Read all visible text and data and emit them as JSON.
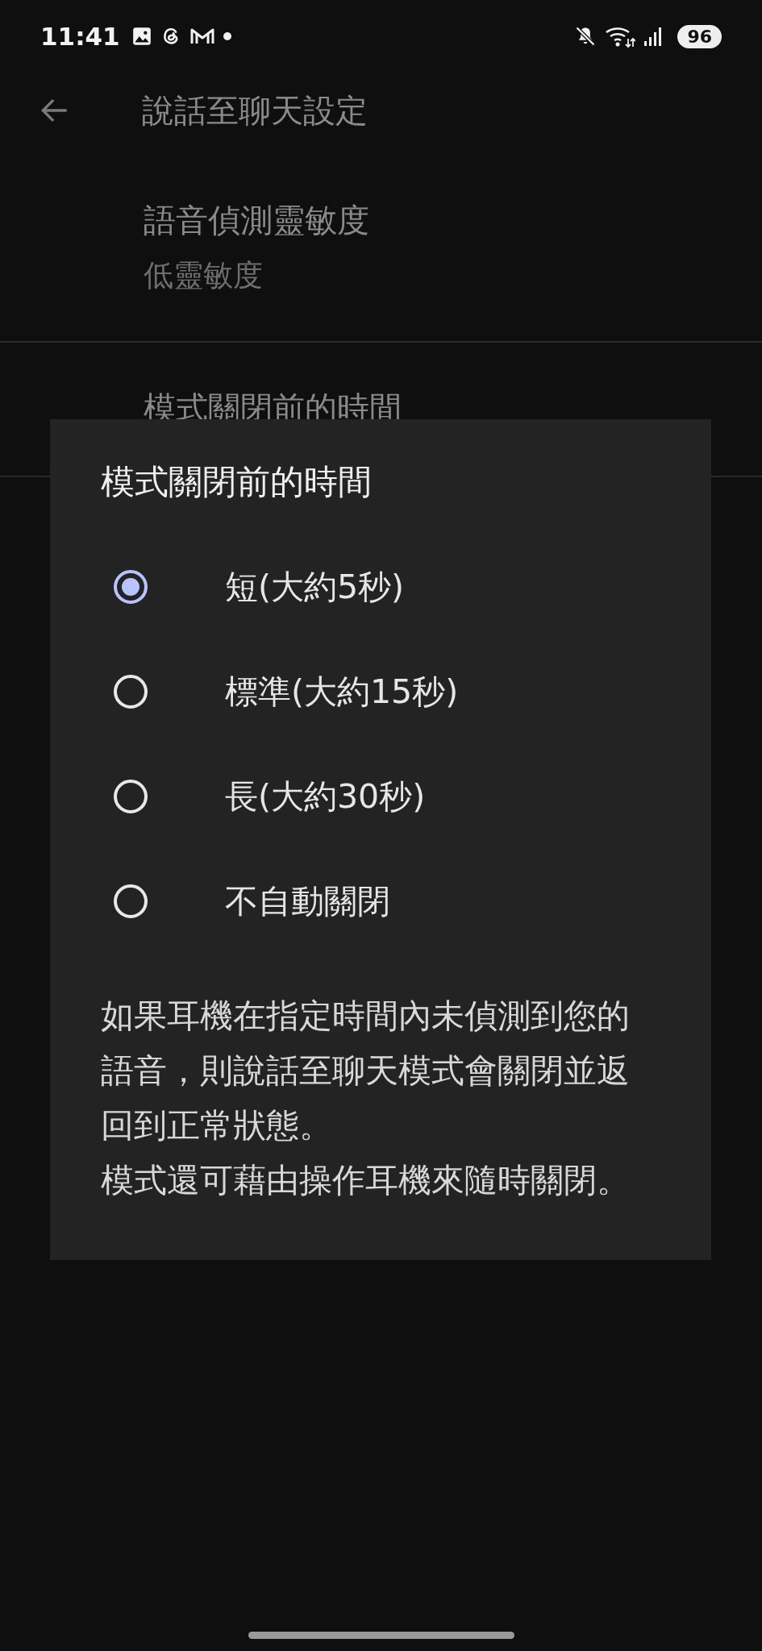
{
  "status_bar": {
    "time": "11:41",
    "battery": "96"
  },
  "header": {
    "title": "說話至聊天設定"
  },
  "settings": [
    {
      "title": "語音偵測靈敏度",
      "subtitle": "低靈敏度"
    },
    {
      "title": "模式關閉前的時間"
    }
  ],
  "dialog": {
    "title": "模式關閉前的時間",
    "options": [
      {
        "label": "短(大約5秒)",
        "selected": true
      },
      {
        "label": "標準(大約15秒)",
        "selected": false
      },
      {
        "label": "長(大約30秒)",
        "selected": false
      },
      {
        "label": "不自動關閉",
        "selected": false
      }
    ],
    "description": [
      "如果耳機在指定時間內未偵測到您的語音，則說話至聊天模式會關閉並返回到正常狀態。",
      "模式還可藉由操作耳機來隨時關閉。"
    ]
  }
}
